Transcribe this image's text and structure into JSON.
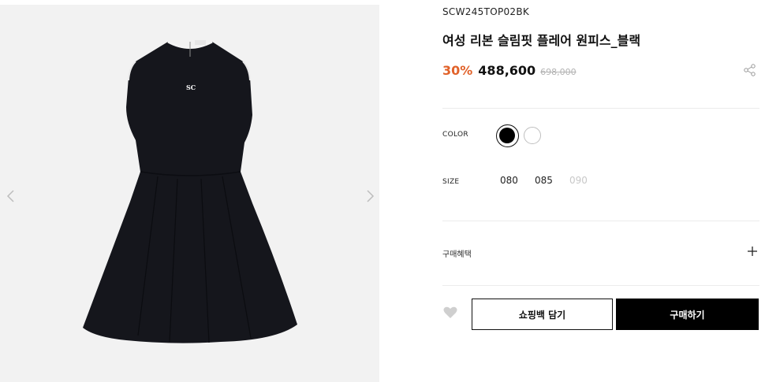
{
  "product": {
    "sku": "SCW245TOP02BK",
    "title": "여성 리본 슬림핏 플레어 원피스_블랙",
    "discount": "30%",
    "sale_price": "488,600",
    "original_price": "698,000",
    "image_logo": "SC"
  },
  "gallery": {
    "prev_icon": "chevron-left-icon",
    "next_icon": "chevron-right-icon"
  },
  "options": {
    "color_label": "COLOR",
    "colors": [
      {
        "name": "black",
        "hex": "#000000",
        "selected": true
      },
      {
        "name": "white",
        "hex": "#ffffff",
        "selected": false
      }
    ],
    "size_label": "SIZE",
    "sizes": [
      {
        "label": "080",
        "available": true
      },
      {
        "label": "085",
        "available": true
      },
      {
        "label": "090",
        "available": false
      }
    ]
  },
  "benefits": {
    "label": "구매혜택",
    "expand_icon": "plus-icon"
  },
  "actions": {
    "wishlist_icon": "heart-icon",
    "cart_label": "쇼핑백 담기",
    "buy_label": "구매하기",
    "share_icon": "share-icon"
  },
  "colors": {
    "accent_discount": "#e1622a",
    "primary_button": "#000000",
    "disabled_text": "#c8c8c8"
  }
}
